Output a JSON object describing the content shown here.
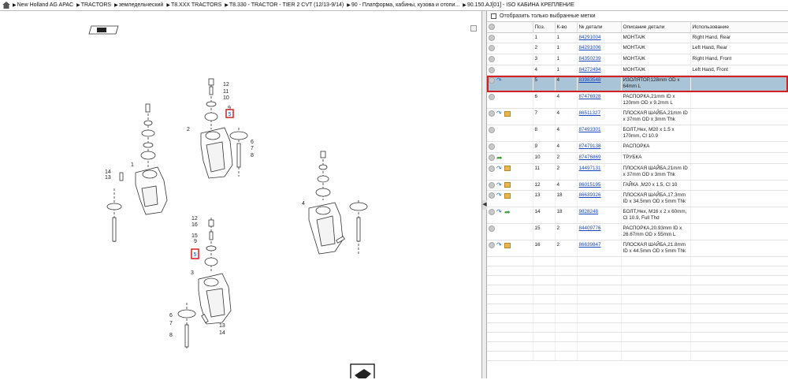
{
  "breadcrumbs": [
    "New Holland AG APAC",
    "TRACTORS",
    "земледельческий",
    "T8.XXX TRACTORS",
    "T8.330 - TRACTOR - TIER 2 CVT (12/13-9/14)",
    "90 - Платформа, кабины, кузова и отопи...",
    "90.150.AJ[01] - ISO КАБИНА КРЕПЛЕНИЕ"
  ],
  "filter": {
    "label": "Отобразить только выбранные метки"
  },
  "table": {
    "headers": [
      "",
      "Поз.",
      "К-во",
      "№ детали",
      "Описание детали",
      "Использование"
    ],
    "rows": [
      {
        "icons": "plain",
        "pos": "1",
        "qty": "1",
        "part": "84291004",
        "desc": "МОНТАЖ",
        "usage": "Right Hand, Rear"
      },
      {
        "icons": "plain",
        "pos": "2",
        "qty": "1",
        "part": "84291006",
        "desc": "МОНТАЖ",
        "usage": "Left Hand, Rear"
      },
      {
        "icons": "plain",
        "pos": "3",
        "qty": "1",
        "part": "84350239",
        "desc": "МОНТАЖ",
        "usage": "Right Hand, Front"
      },
      {
        "icons": "plain",
        "pos": "4",
        "qty": "1",
        "part": "84272494",
        "desc": "МОНТАЖ",
        "usage": "Left Hand, Front"
      },
      {
        "icons": "arrow",
        "pos": "5",
        "qty": "4",
        "part": "83983548",
        "desc": "ИЗОЛЯТОР,128mm OD x 64mm L",
        "usage": "",
        "selected": true
      },
      {
        "icons": "plain",
        "pos": "6",
        "qty": "4",
        "part": "87476928",
        "desc": "РАСПОРКА,21mm ID x 120mm OD x 9.2mm L",
        "usage": ""
      },
      {
        "icons": "arrow-box",
        "pos": "7",
        "qty": "4",
        "part": "86511327",
        "desc": "ПЛОСКАЯ ШАЙБА,21mm ID x 37mm OD x 3mm Thk",
        "usage": ""
      },
      {
        "icons": "plain",
        "pos": "8",
        "qty": "4",
        "part": "87493301",
        "desc": "БОЛТ,Hex, M20 x 1.5 x 170mm, Cl 10.9",
        "usage": ""
      },
      {
        "icons": "plain",
        "pos": "9",
        "qty": "4",
        "part": "87479138",
        "desc": "РАСПОРКА",
        "usage": ""
      },
      {
        "icons": "green",
        "pos": "10",
        "qty": "2",
        "part": "87476869",
        "desc": "ТРУБКА",
        "usage": ""
      },
      {
        "icons": "arrow-box",
        "pos": "11",
        "qty": "2",
        "part": "14497131",
        "desc": "ПЛОСКАЯ ШАЙБА,21mm ID x 37mm OD x 3mm Thk",
        "usage": ""
      },
      {
        "icons": "arrow-box",
        "pos": "12",
        "qty": "4",
        "part": "86015195",
        "desc": "ГАЙКА ,M20 x 1.5, Cl 10",
        "usage": ""
      },
      {
        "icons": "arrow-box",
        "pos": "13",
        "qty": "18",
        "part": "86639326",
        "desc": "ПЛОСКАЯ ШАЙБА,17.3mm ID x 34.5mm OD x 5mm Thk",
        "usage": ""
      },
      {
        "icons": "arrow-green",
        "pos": "14",
        "qty": "18",
        "part": "9828248",
        "desc": "БОЛТ,Hex, M16 x 2 x 60mm, Cl 10.9, Full Thd",
        "usage": ""
      },
      {
        "icons": "plain",
        "pos": "15",
        "qty": "2",
        "part": "84409776",
        "desc": "РАСПОРКА,20.93mm ID x 26.67mm OD x 55mm L",
        "usage": ""
      },
      {
        "icons": "arrow-box",
        "pos": "16",
        "qty": "2",
        "part": "86639847",
        "desc": "ПЛОСКАЯ ШАЙБА,21.8mm ID x 44.5mm OD x 5mm Thk",
        "usage": ""
      }
    ]
  },
  "diagram": {
    "callouts": [
      "1",
      "2",
      "3",
      "4",
      "5",
      "6",
      "7",
      "8",
      "9",
      "10",
      "11",
      "12",
      "13",
      "14",
      "15",
      "16"
    ],
    "highlighted_callout": "5"
  },
  "colors": {
    "selected_row": "#a9c4d6",
    "highlight_border": "#d42020",
    "link": "#1a47c0"
  }
}
